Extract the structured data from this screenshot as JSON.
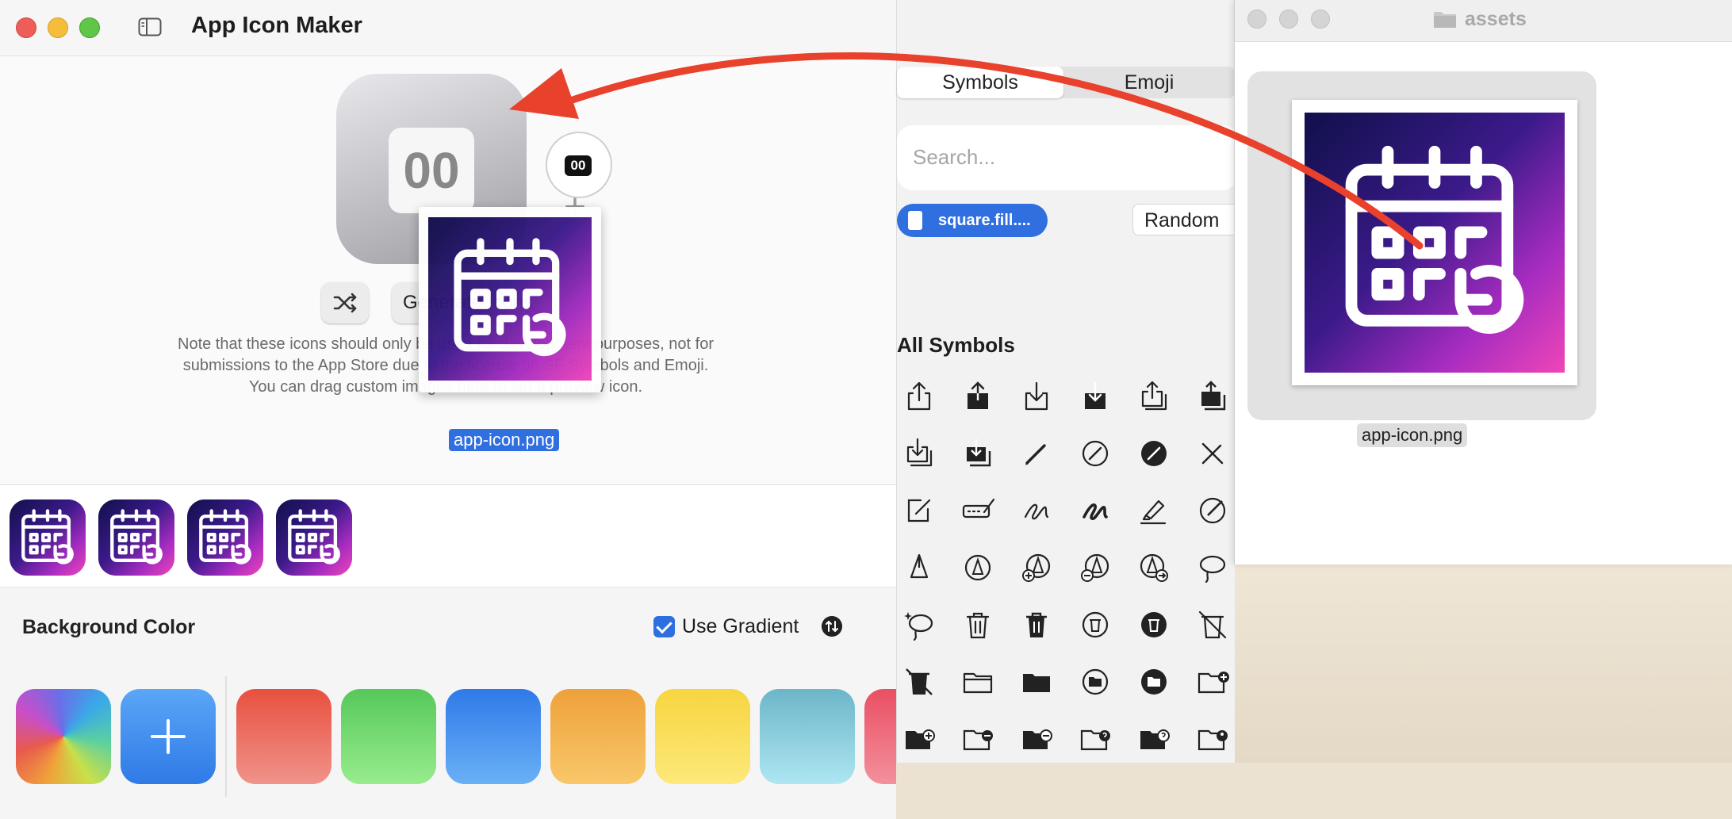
{
  "app": {
    "title": "App Icon Maker",
    "preview_badge_text": "00",
    "preview_inner_text": "00",
    "preview_plus": "+",
    "generate_label": "Generate Icons",
    "note_lines": [
      "Note that these icons should only be used for development purposes, not for",
      "submissions to the App Store due to the license on SF Symbols and Emoji.",
      "You can drag custom images here to set a preview icon."
    ],
    "dragged_file": "app-icon.png"
  },
  "background": {
    "title": "Background Color",
    "use_gradient_label": "Use Gradient",
    "use_gradient": true,
    "swatches": [
      {
        "name": "color-wheel",
        "color": "conic"
      },
      {
        "name": "add",
        "color": "#3d8df0"
      },
      {
        "name": "red",
        "color": "#e85a4e"
      },
      {
        "name": "green",
        "color": "#63d36a"
      },
      {
        "name": "blue",
        "color": "#3b86ef"
      },
      {
        "name": "orange",
        "color": "#f0a23a"
      },
      {
        "name": "yellow",
        "color": "#f9d94e"
      },
      {
        "name": "teal",
        "color": "#7fcad8"
      },
      {
        "name": "pink",
        "color": "#ef6a7a"
      }
    ]
  },
  "picker": {
    "tabs": [
      "Symbols",
      "Emoji"
    ],
    "active_tab": "Symbols",
    "search_placeholder": "Search...",
    "selected_symbol": "square.fill....",
    "random_label": "Random",
    "all_symbols_title": "All Symbols"
  },
  "finder": {
    "title": "assets",
    "file_name": "app-icon.png"
  },
  "colors": {
    "accent": "#2f6fe0",
    "arrow": "#e8412c",
    "icon_gradient": [
      "#1a1a6e",
      "#6a1fb0",
      "#e23fa8"
    ]
  }
}
